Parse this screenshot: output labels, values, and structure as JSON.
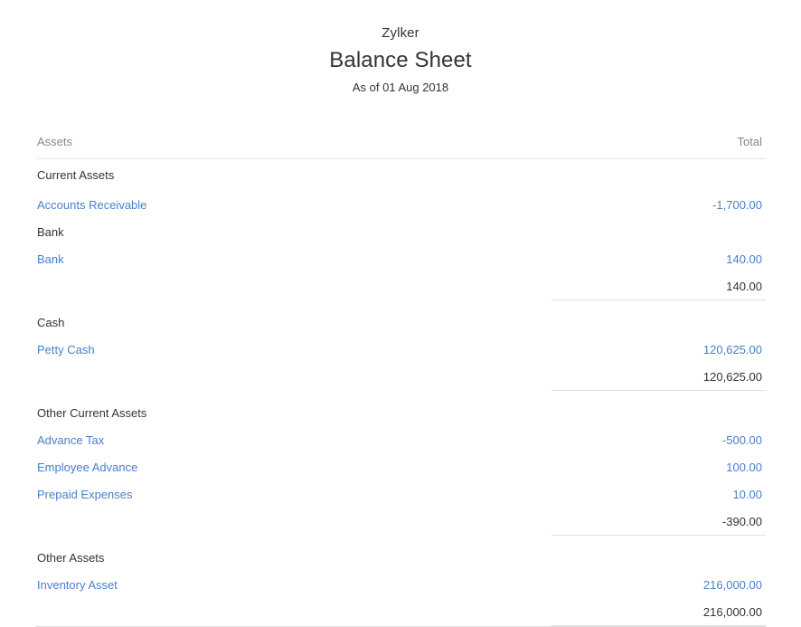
{
  "report": {
    "organization": "Zylker",
    "title": "Balance Sheet",
    "period": "As of 01 Aug 2018"
  },
  "table": {
    "columns": {
      "label": "Assets",
      "total": "Total"
    },
    "rows": [
      {
        "type": "group",
        "label": "Current Assets",
        "value": ""
      },
      {
        "type": "account",
        "label": "Accounts Receivable",
        "value": "-1,700.00"
      },
      {
        "type": "group",
        "label": "Bank",
        "value": ""
      },
      {
        "type": "account",
        "label": "Bank",
        "value": "140.00"
      },
      {
        "type": "subtotal",
        "label": "",
        "value": "140.00"
      },
      {
        "type": "group",
        "label": "Cash",
        "value": ""
      },
      {
        "type": "account",
        "label": "Petty Cash",
        "value": "120,625.00"
      },
      {
        "type": "subtotal",
        "label": "",
        "value": "120,625.00"
      },
      {
        "type": "group",
        "label": "Other Current Assets",
        "value": ""
      },
      {
        "type": "account",
        "label": "Advance Tax",
        "value": "-500.00"
      },
      {
        "type": "account",
        "label": "Employee Advance",
        "value": "100.00"
      },
      {
        "type": "account",
        "label": "Prepaid Expenses",
        "value": "10.00"
      },
      {
        "type": "subtotal",
        "label": "",
        "value": "-390.00"
      },
      {
        "type": "group",
        "label": "Other Assets",
        "value": ""
      },
      {
        "type": "account",
        "label": "Inventory Asset",
        "value": "216,000.00"
      },
      {
        "type": "subtotal",
        "label": "",
        "value": "216,000.00"
      }
    ]
  },
  "colors": {
    "link": "#4a7fc9",
    "text": "#333333",
    "muted": "#888888",
    "rule": "#e0e0e0",
    "background": "#ffffff"
  }
}
